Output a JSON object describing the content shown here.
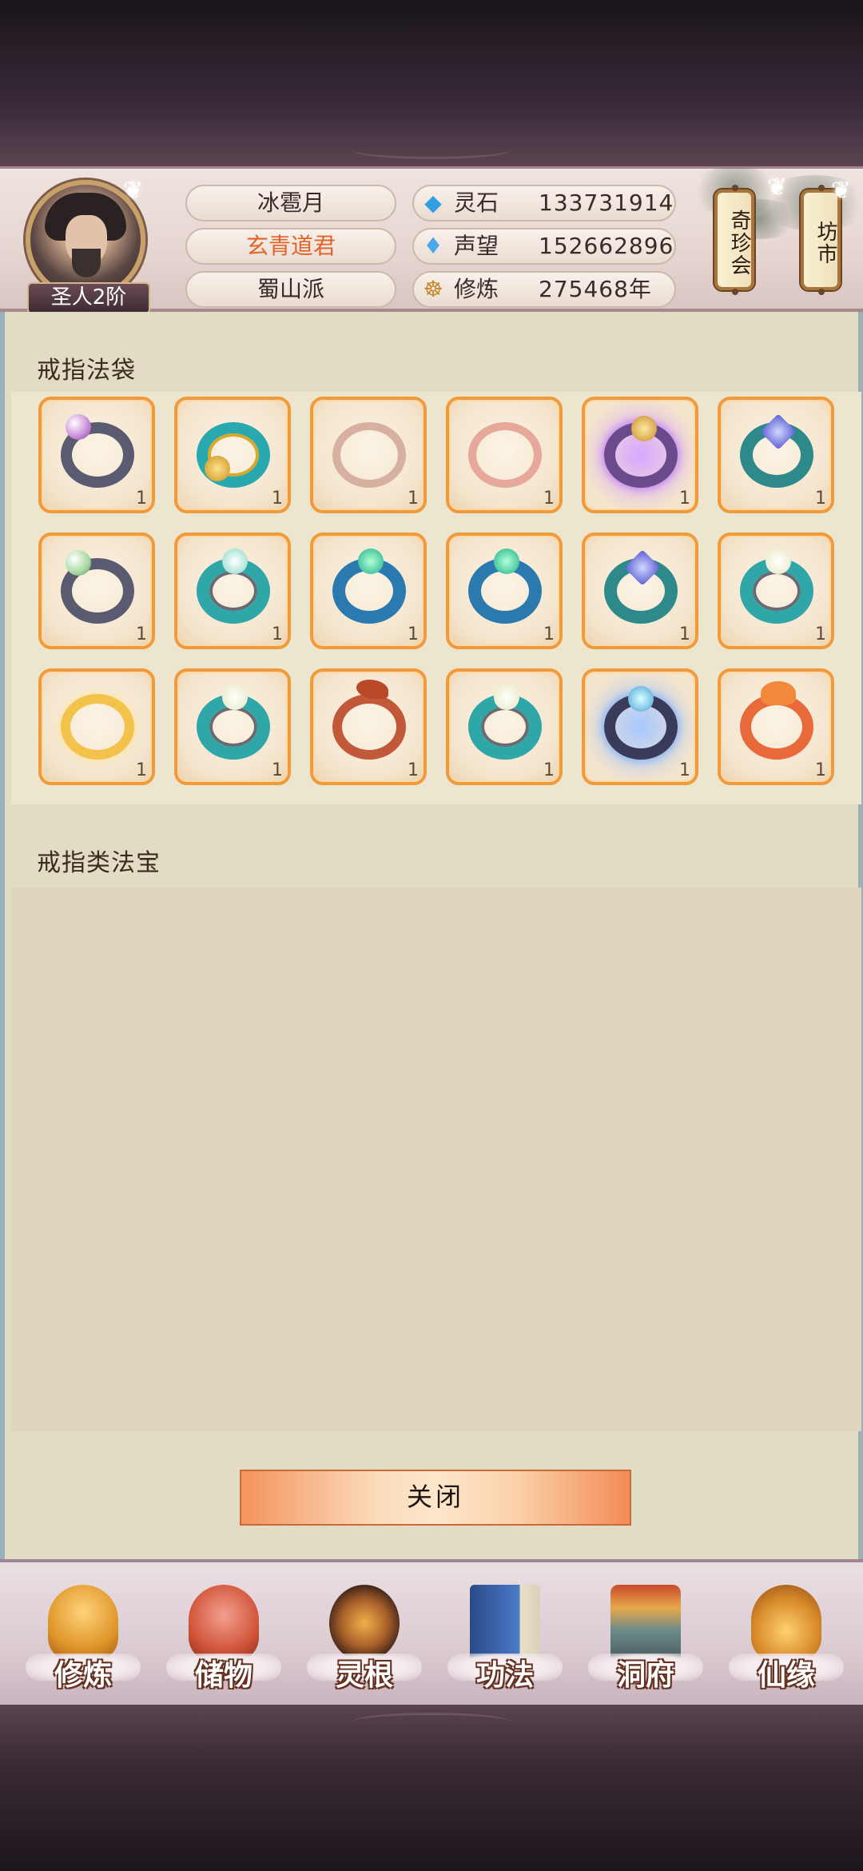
{
  "header": {
    "player_rank": "圣人2阶",
    "name_rows": [
      "冰雹月",
      "玄青道君",
      "蜀山派"
    ],
    "stats": [
      {
        "icon": "spirit-stone-icon",
        "label": "灵石",
        "value": "133731914"
      },
      {
        "icon": "prestige-crystal-icon",
        "label": "声望",
        "value": "152662896"
      },
      {
        "icon": "meditation-icon",
        "label": "修炼",
        "value": "275468年"
      }
    ],
    "side_buttons": [
      "奇珍会",
      "坊市"
    ]
  },
  "storage": {
    "bag_title": "戒指法袋",
    "treasure_title": "戒指类法宝",
    "rings": [
      {
        "name": "purple-pearl-ring",
        "count": "1"
      },
      {
        "name": "gold-teal-ring",
        "count": "1"
      },
      {
        "name": "rose-silver-ring",
        "count": "1"
      },
      {
        "name": "pink-silver-ring",
        "count": "1"
      },
      {
        "name": "violet-aura-ring",
        "count": "1"
      },
      {
        "name": "blue-sapphire-ring",
        "count": "1"
      },
      {
        "name": "green-pearl-ring",
        "count": "1"
      },
      {
        "name": "teal-jade-ring",
        "count": "1"
      },
      {
        "name": "azure-emerald-ring",
        "count": "1"
      },
      {
        "name": "azure-emerald-ring-2",
        "count": "1"
      },
      {
        "name": "sapphire-band-ring",
        "count": "1"
      },
      {
        "name": "teal-jade-ring-2",
        "count": "1"
      },
      {
        "name": "golden-dragon-ring",
        "count": "1"
      },
      {
        "name": "teal-jade-ring-3",
        "count": "1"
      },
      {
        "name": "crimson-dragon-ring",
        "count": "1"
      },
      {
        "name": "teal-jade-ring-4",
        "count": "1"
      },
      {
        "name": "spectral-blue-ring",
        "count": "1"
      },
      {
        "name": "flame-serpent-ring",
        "count": "1"
      }
    ],
    "close_label": "关闭"
  },
  "nav": {
    "items": [
      {
        "label": "修炼",
        "icon": "cultivate-icon",
        "color": "#e0962a"
      },
      {
        "label": "储物",
        "icon": "storage-bag-icon",
        "color": "#d2553a"
      },
      {
        "label": "灵根",
        "icon": "spirit-root-icon",
        "color": "#a8602a"
      },
      {
        "label": "功法",
        "icon": "technique-book-icon",
        "color": "#3a6aa8"
      },
      {
        "label": "洞府",
        "icon": "cave-dwelling-icon",
        "color": "#c08a3a"
      },
      {
        "label": "仙缘",
        "icon": "immortal-fate-icon",
        "color": "#d88a2a"
      }
    ]
  },
  "colors": {
    "panel_bg": "#e3dcc4",
    "slot_border": "#f09a3e",
    "highlight_name": "#e0642a"
  }
}
